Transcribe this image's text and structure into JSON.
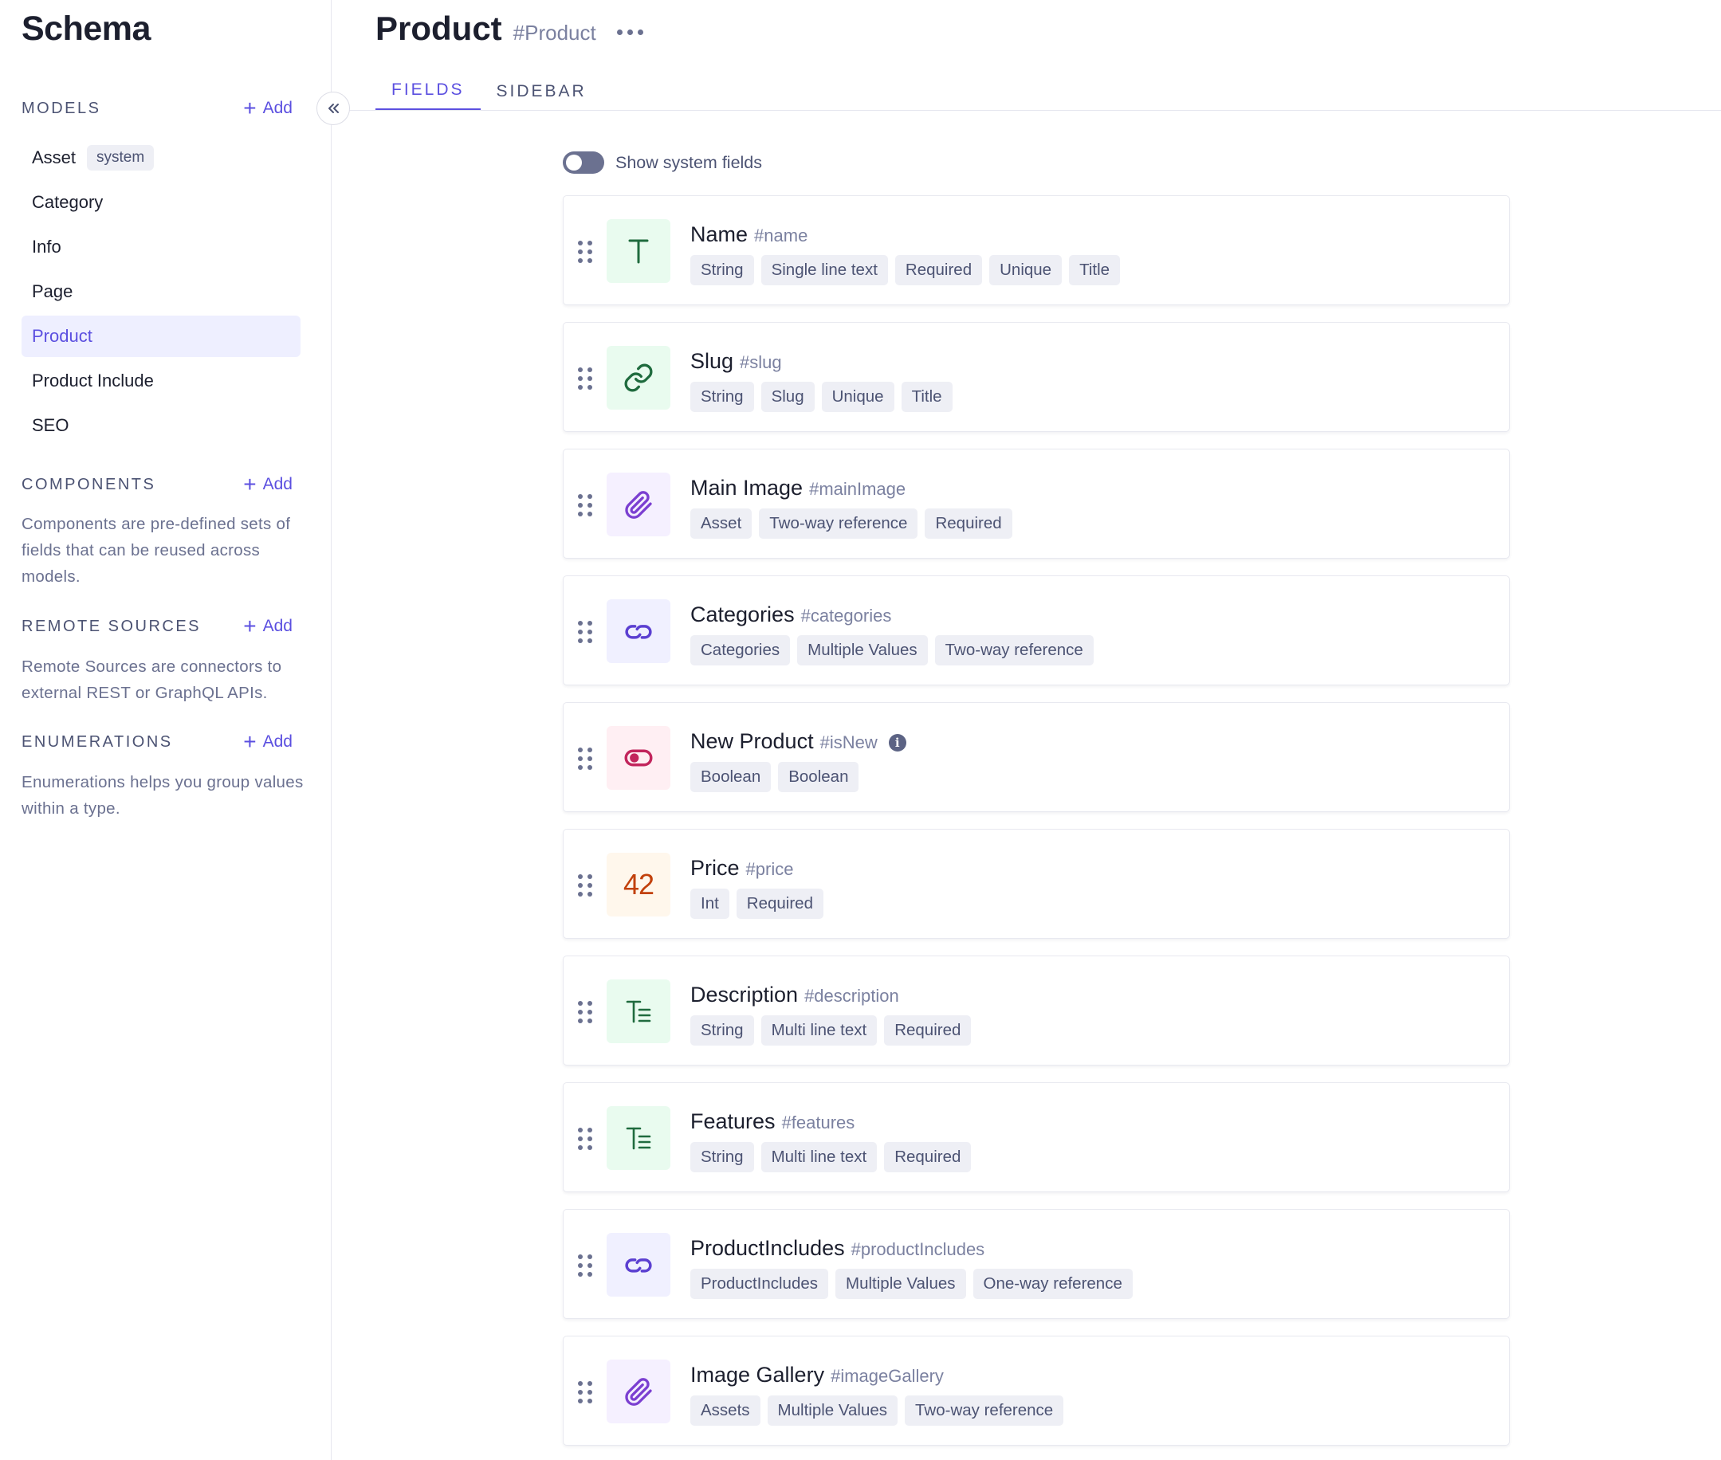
{
  "sidebar": {
    "title": "Schema",
    "models": {
      "heading": "MODELS",
      "add_label": "Add",
      "items": [
        {
          "label": "Asset",
          "badge": "system"
        },
        {
          "label": "Category"
        },
        {
          "label": "Info"
        },
        {
          "label": "Page"
        },
        {
          "label": "Product",
          "active": true
        },
        {
          "label": "Product Include"
        },
        {
          "label": "SEO"
        }
      ]
    },
    "components": {
      "heading": "COMPONENTS",
      "add_label": "Add",
      "description": "Components are pre-defined sets of fields that can be reused across models."
    },
    "remote_sources": {
      "heading": "REMOTE SOURCES",
      "add_label": "Add",
      "description": "Remote Sources are connectors to external REST or GraphQL APIs."
    },
    "enumerations": {
      "heading": "ENUMERATIONS",
      "add_label": "Add",
      "description": "Enumerations helps you group values within a type."
    }
  },
  "header": {
    "title": "Product",
    "api_id": "#Product",
    "tabs": [
      {
        "label": "FIELDS",
        "active": true
      },
      {
        "label": "SIDEBAR"
      }
    ]
  },
  "toggle": {
    "label": "Show system fields",
    "on": false
  },
  "fields": [
    {
      "name": "Name",
      "api": "#name",
      "icon": "text-icon",
      "chips": [
        "String",
        "Single line text",
        "Required",
        "Unique",
        "Title"
      ]
    },
    {
      "name": "Slug",
      "api": "#slug",
      "icon": "link-icon",
      "chips": [
        "String",
        "Slug",
        "Unique",
        "Title"
      ]
    },
    {
      "name": "Main Image",
      "api": "#mainImage",
      "icon": "paperclip-icon",
      "chips": [
        "Asset",
        "Two-way reference",
        "Required"
      ]
    },
    {
      "name": "Categories",
      "api": "#categories",
      "icon": "reference-icon",
      "chips": [
        "Categories",
        "Multiple Values",
        "Two-way reference"
      ]
    },
    {
      "name": "New Product",
      "api": "#isNew",
      "icon": "toggle-icon",
      "info": "i",
      "chips": [
        "Boolean",
        "Boolean"
      ]
    },
    {
      "name": "Price",
      "api": "#price",
      "icon": "number-icon",
      "icon_text": "42",
      "chips": [
        "Int",
        "Required"
      ]
    },
    {
      "name": "Description",
      "api": "#description",
      "icon": "multiline-text-icon",
      "chips": [
        "String",
        "Multi line text",
        "Required"
      ]
    },
    {
      "name": "Features",
      "api": "#features",
      "icon": "multiline-text-icon",
      "chips": [
        "String",
        "Multi line text",
        "Required"
      ]
    },
    {
      "name": "ProductIncludes",
      "api": "#productIncludes",
      "icon": "reference-icon",
      "chips": [
        "ProductIncludes",
        "Multiple Values",
        "One-way reference"
      ]
    },
    {
      "name": "Image Gallery",
      "api": "#imageGallery",
      "icon": "paperclip-icon",
      "chips": [
        "Assets",
        "Multiple Values",
        "Two-way reference"
      ]
    }
  ],
  "colors": {
    "accent": "#5b4fe0",
    "text": "#1c1f2e",
    "muted": "#4c5373",
    "chip_bg": "#eeeff5"
  }
}
